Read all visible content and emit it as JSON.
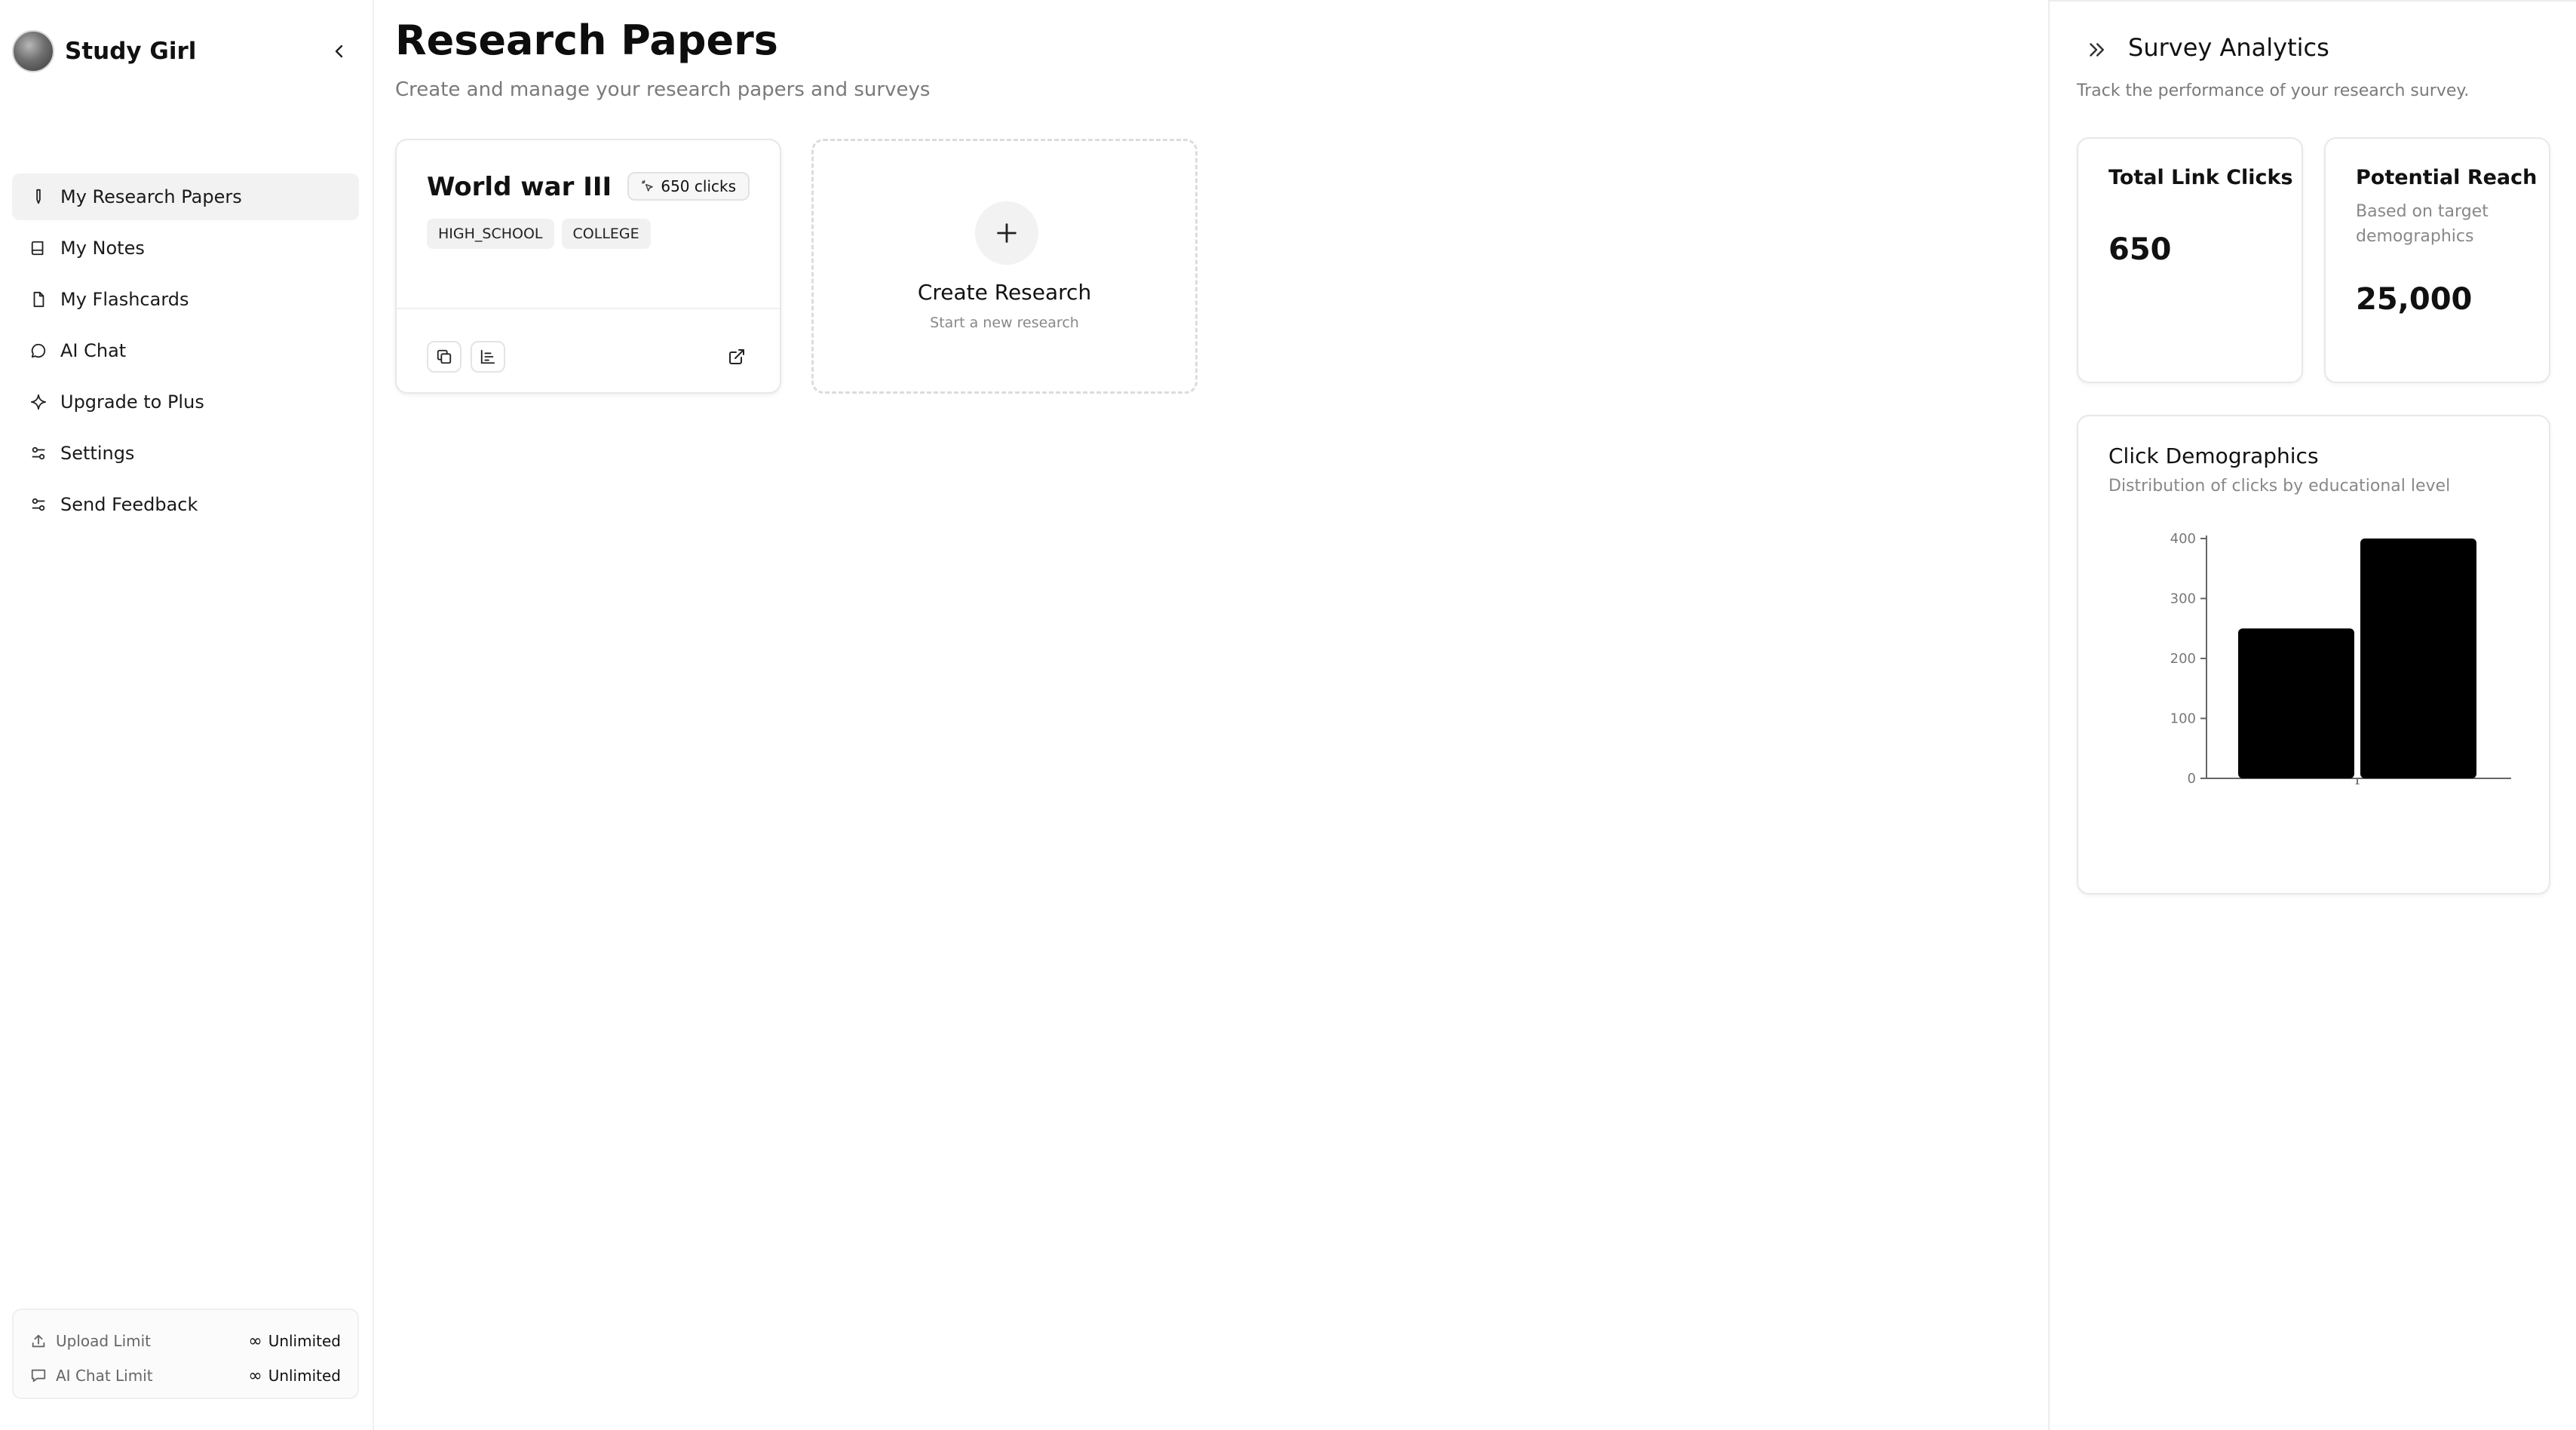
{
  "sidebar": {
    "brand": "Study Girl",
    "items": [
      {
        "label": "My Research Papers",
        "icon": "pen-icon",
        "active": true
      },
      {
        "label": "My Notes",
        "icon": "book-icon",
        "active": false
      },
      {
        "label": "My Flashcards",
        "icon": "file-icon",
        "active": false
      },
      {
        "label": "AI Chat",
        "icon": "chat-bubble-icon",
        "active": false
      },
      {
        "label": "Upgrade to Plus",
        "icon": "sparkle-icon",
        "active": false
      },
      {
        "label": "Settings",
        "icon": "sliders-icon",
        "active": false
      },
      {
        "label": "Send Feedback",
        "icon": "sliders-icon",
        "active": false
      }
    ],
    "limits": [
      {
        "label": "Upload Limit",
        "value": "Unlimited",
        "icon": "upload-icon"
      },
      {
        "label": "AI Chat Limit",
        "value": "Unlimited",
        "icon": "chat-bubble-icon"
      }
    ]
  },
  "main": {
    "title": "Research Papers",
    "subtitle": "Create and manage your research papers and surveys",
    "papers": [
      {
        "title": "World war III",
        "clicks": "650 clicks",
        "tags": [
          "HIGH_SCHOOL",
          "COLLEGE"
        ]
      }
    ],
    "create": {
      "title": "Create Research",
      "subtitle": "Start a new research"
    }
  },
  "panel": {
    "title": "Survey Analytics",
    "subtitle": "Track the performance of your research survey.",
    "total_clicks": {
      "title": "Total Link Clicks",
      "value": "650"
    },
    "reach": {
      "title": "Potential Reach",
      "subtitle": "Based on target demographics",
      "value": "25,000"
    },
    "chart_card": {
      "title": "Click Demographics",
      "subtitle": "Distribution of clicks by educational level"
    }
  },
  "chart_data": {
    "type": "bar",
    "categories": [
      "",
      "1"
    ],
    "values": [
      250,
      400
    ],
    "yticks": [
      0,
      100,
      200,
      300,
      400
    ],
    "ylim": [
      0,
      400
    ],
    "grid": false,
    "bar_color": "#000000"
  }
}
